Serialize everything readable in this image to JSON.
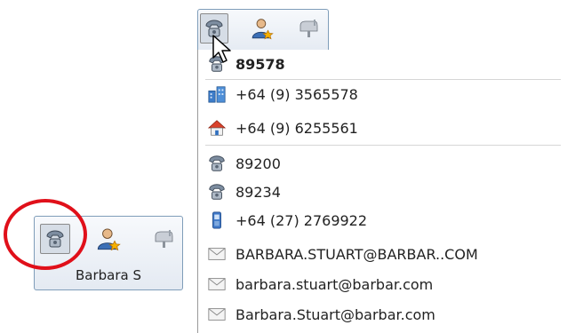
{
  "contact_card": {
    "name": "Barbara S"
  },
  "menu": {
    "items": [
      {
        "icon": "phone-icon",
        "label": "89578",
        "bold": true
      },
      {
        "icon": "office-icon",
        "label": "+64 (9) 3565578"
      },
      {
        "icon": "home-icon",
        "label": "+64 (9) 6255561"
      },
      {
        "icon": "phone-icon",
        "label": "89200"
      },
      {
        "icon": "phone-icon",
        "label": "89234"
      },
      {
        "icon": "mobile-icon",
        "label": "+64 (27) 2769922"
      },
      {
        "icon": "email-icon",
        "label": "BARBARA.STUART@BARBAR..COM"
      },
      {
        "icon": "email-icon",
        "label": "barbara.stuart@barbar.com"
      },
      {
        "icon": "email-icon",
        "label": "Barbara.Stuart@barbar.com"
      }
    ]
  },
  "colors": {
    "highlight_ring": "#e0101a",
    "border": "#7f9db9"
  }
}
